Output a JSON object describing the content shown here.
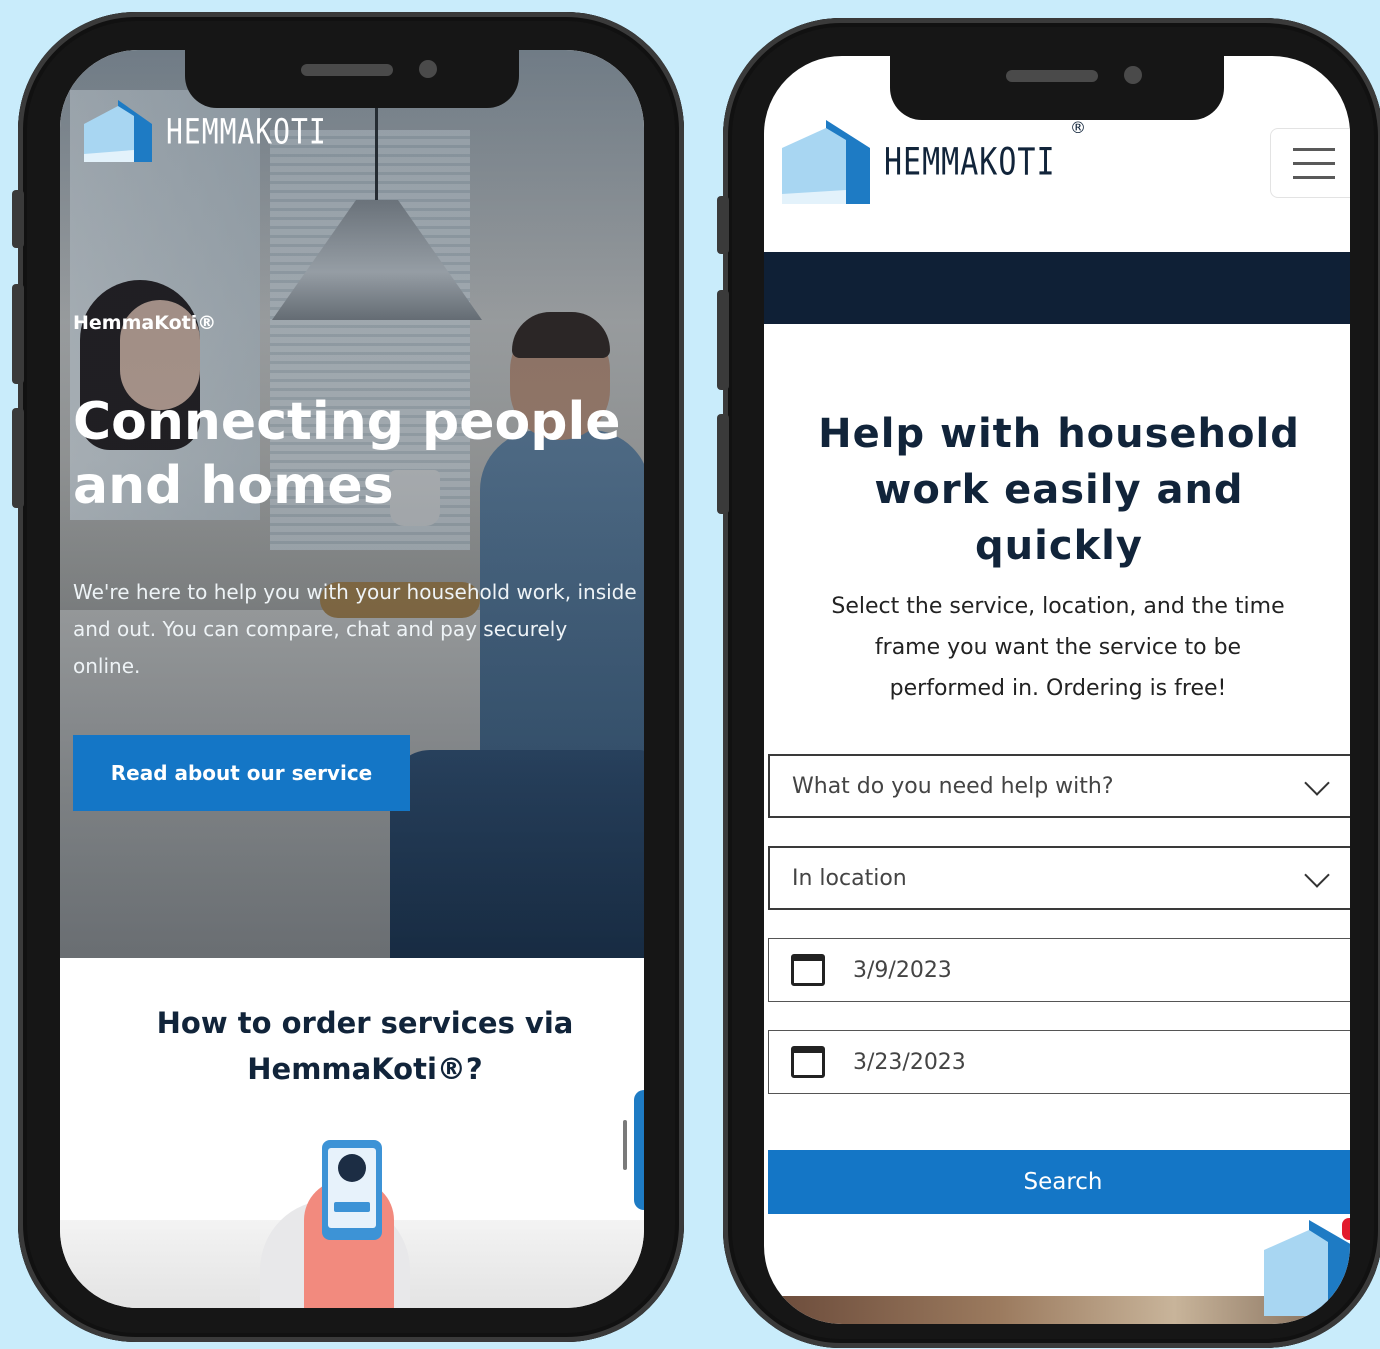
{
  "colors": {
    "background": "#c9ecfb",
    "brand_blue": "#1476c6",
    "navy": "#0f2036",
    "logo_light": "#a8d6f2",
    "logo_dark": "#1e7bc4"
  },
  "left_phone": {
    "logo": {
      "icon": "house-logo-icon",
      "wordmark": "HEMMAKOTI"
    },
    "hero": {
      "eyebrow": "HemmaKoti®",
      "title": "Connecting people and homes",
      "description": "We're here to help you with your household work, inside and out. You can compare, chat and pay securely online.",
      "cta_label": "Read about our service"
    },
    "how_to": {
      "title": "How to order services via HemmaKoti®?",
      "illustration_icon": "phone-signup-illustration"
    }
  },
  "right_phone": {
    "logo": {
      "icon": "house-logo-icon",
      "wordmark": "HEMMAKOTI",
      "registered": "®"
    },
    "menu_icon": "hamburger-menu-icon",
    "title": "Help with household work easily and quickly",
    "description": "Select the service, location, and the time frame you want the service to be performed in. Ordering is free!",
    "form": {
      "service_placeholder": "What do you need help with?",
      "location_placeholder": "In location",
      "start_date": "3/9/2023",
      "end_date": "3/23/2023",
      "search_label": "Search"
    }
  }
}
